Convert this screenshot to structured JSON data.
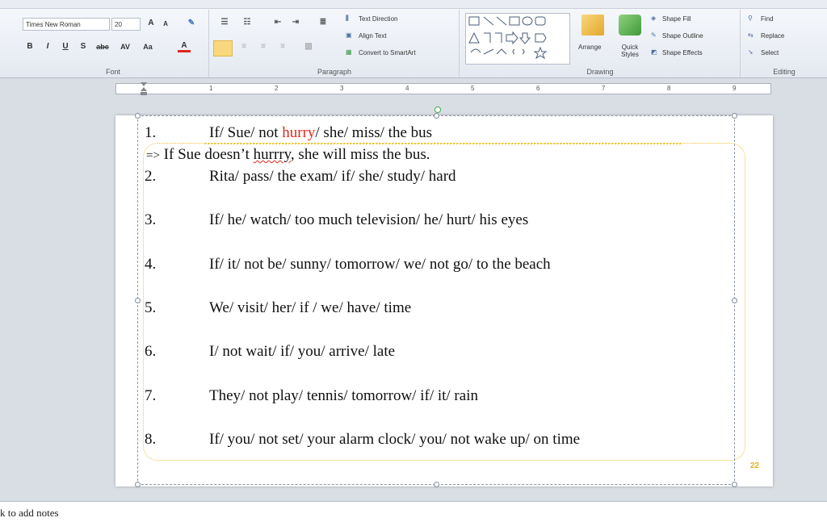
{
  "ribbon": {
    "font": {
      "label": "Font",
      "font_name": "Times New Roman",
      "font_size": "20",
      "bold": "B",
      "italic": "I",
      "underline": "U",
      "shadow": "S",
      "strikethrough": "abc",
      "spacing": "AV",
      "change_case": "Aa",
      "grow": "A",
      "shrink": "A",
      "color": "A"
    },
    "paragraph": {
      "label": "Paragraph",
      "text_direction": "Text Direction",
      "align_text": "Align Text",
      "convert_smartart": "Convert to SmartArt"
    },
    "drawing": {
      "label": "Drawing",
      "arrange": "Arrange",
      "quick_styles": "Quick Styles",
      "shape_fill": "Shape Fill",
      "shape_outline": "Shape Outline",
      "shape_effects": "Shape Effects"
    },
    "editing": {
      "label": "Editing",
      "find": "Find",
      "replace": "Replace",
      "select": "Select"
    }
  },
  "ruler": {
    "marks": [
      "1",
      "2",
      "3",
      "4",
      "5",
      "6",
      "7",
      "8",
      "9"
    ]
  },
  "slide": {
    "items": [
      {
        "num": "1.",
        "pre": "If/ Sue/ not ",
        "highlight": "hurry",
        "post": "/ she/ miss/ the bus"
      },
      {
        "num": "2.",
        "text": "Rita/ pass/ the exam/ if/ she/ study/ hard"
      },
      {
        "num": "3.",
        "text": "If/ he/ watch/ too much television/ he/ hurt/ his eyes"
      },
      {
        "num": "4.",
        "text": "If/ it/ not be/ sunny/ tomorrow/ we/ not go/ to the beach"
      },
      {
        "num": "5.",
        "text": "We/ visit/ her/ if / we/ have/ time"
      },
      {
        "num": "6.",
        "text": "I/ not wait/ if/ you/ arrive/ late"
      },
      {
        "num": "7.",
        "text": "They/ not play/ tennis/ tomorrow/ if/ it/ rain"
      },
      {
        "num": "8.",
        "text": "If/ you/ not set/ your alarm clock/ you/ not wake up/ on time"
      }
    ],
    "answer": {
      "arrow": "=>",
      "pre": " If Sue doesn’t ",
      "misspelled": "hurrry",
      "post": ", she will miss the bus."
    },
    "page_number": "22"
  },
  "notes": {
    "placeholder": "k to add notes"
  }
}
